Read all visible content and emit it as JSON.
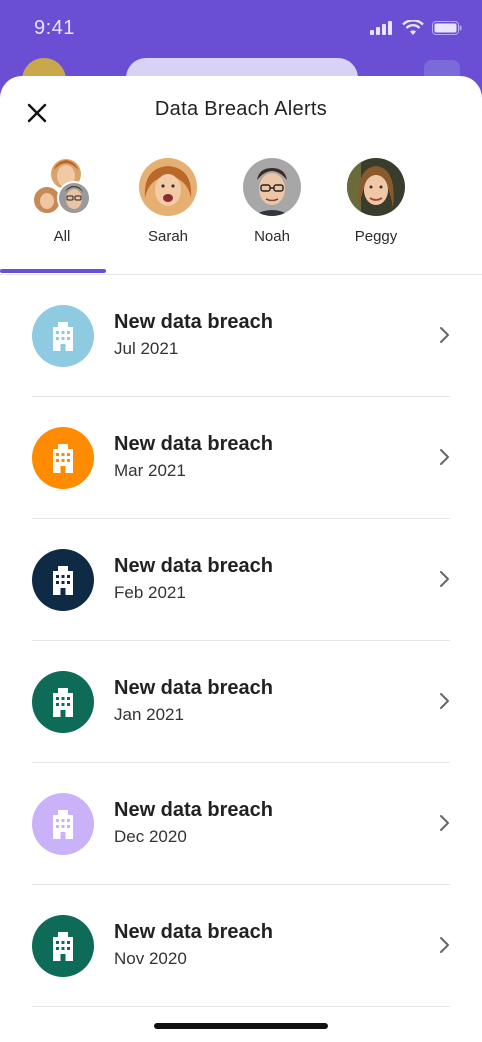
{
  "status_bar": {
    "time": "9:41"
  },
  "sheet": {
    "title": "Data Breach Alerts"
  },
  "tabs": [
    {
      "label": "All",
      "selected": true
    },
    {
      "label": "Sarah",
      "selected": false
    },
    {
      "label": "Noah",
      "selected": false
    },
    {
      "label": "Peggy",
      "selected": false
    }
  ],
  "alerts": [
    {
      "title": "New data breach",
      "date": "Jul 2021",
      "icon": "building-icon",
      "color": "#8fcbe0"
    },
    {
      "title": "New data breach",
      "date": "Mar 2021",
      "icon": "building-icon",
      "color": "#ff8c00"
    },
    {
      "title": "New data breach",
      "date": "Feb 2021",
      "icon": "building-icon",
      "color": "#0f2a44"
    },
    {
      "title": "New data breach",
      "date": "Jan 2021",
      "icon": "building-icon",
      "color": "#0e6b58"
    },
    {
      "title": "New data breach",
      "date": "Dec 2020",
      "icon": "building-icon",
      "color": "#c9b2f7"
    },
    {
      "title": "New data breach",
      "date": "Nov 2020",
      "icon": "building-icon",
      "color": "#0e6b58"
    }
  ],
  "colors": {
    "accent": "#6a4fd4"
  }
}
